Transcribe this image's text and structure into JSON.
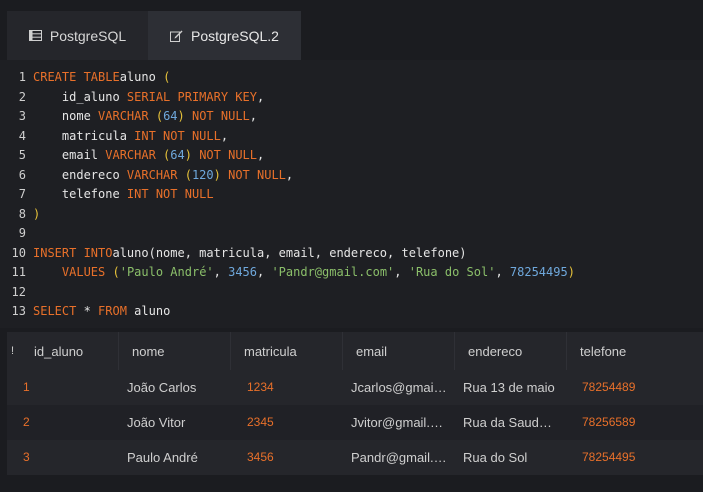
{
  "tabs": [
    {
      "label": "PostgreSQL",
      "icon": "database-icon"
    },
    {
      "label": "PostgreSQL.2",
      "icon": "edit-icon"
    }
  ],
  "editor": {
    "lines": [
      {
        "n": "1",
        "parts": [
          [
            "kw",
            "CREATE TABLE"
          ],
          [
            "",
            "aluno "
          ],
          [
            "pa",
            "("
          ]
        ]
      },
      {
        "n": "2",
        "parts": [
          [
            "",
            "    id_aluno "
          ],
          [
            "kw",
            "SERIAL PRIMARY KEY"
          ],
          [
            "",
            ","
          ]
        ]
      },
      {
        "n": "3",
        "parts": [
          [
            "",
            "    nome "
          ],
          [
            "kw",
            "VARCHAR "
          ],
          [
            "pa",
            "("
          ],
          [
            "num",
            "64"
          ],
          [
            "pa",
            ")"
          ],
          [
            "kw",
            " NOT NULL"
          ],
          [
            "",
            ","
          ]
        ]
      },
      {
        "n": "4",
        "parts": [
          [
            "",
            "    matricula "
          ],
          [
            "kw",
            "INT NOT NULL"
          ],
          [
            "",
            ","
          ]
        ]
      },
      {
        "n": "5",
        "parts": [
          [
            "",
            "    email "
          ],
          [
            "kw",
            "VARCHAR "
          ],
          [
            "pa",
            "("
          ],
          [
            "num",
            "64"
          ],
          [
            "pa",
            ")"
          ],
          [
            "kw",
            " NOT NULL"
          ],
          [
            "",
            ","
          ]
        ]
      },
      {
        "n": "6",
        "parts": [
          [
            "",
            "    endereco "
          ],
          [
            "kw",
            "VARCHAR "
          ],
          [
            "pa",
            "("
          ],
          [
            "num",
            "120"
          ],
          [
            "pa",
            ")"
          ],
          [
            "kw",
            " NOT NULL"
          ],
          [
            "",
            ","
          ]
        ]
      },
      {
        "n": "7",
        "parts": [
          [
            "",
            "    telefone "
          ],
          [
            "kw",
            "INT NOT NULL"
          ]
        ]
      },
      {
        "n": "8",
        "parts": [
          [
            "pa",
            ")"
          ]
        ]
      },
      {
        "n": "9",
        "parts": []
      },
      {
        "n": "10",
        "parts": [
          [
            "kw",
            "INSERT INTO"
          ],
          [
            "",
            "aluno(nome, matricula, email, endereco, telefone)"
          ]
        ]
      },
      {
        "n": "11",
        "parts": [
          [
            "",
            "    "
          ],
          [
            "kw",
            "VALUES "
          ],
          [
            "pa",
            "("
          ],
          [
            "str",
            "'Paulo André'"
          ],
          [
            "",
            ", "
          ],
          [
            "num",
            "3456"
          ],
          [
            "",
            ", "
          ],
          [
            "str",
            "'Pandr@gmail.com'"
          ],
          [
            "",
            ", "
          ],
          [
            "str",
            "'Rua do Sol'"
          ],
          [
            "",
            ", "
          ],
          [
            "num",
            "78254495"
          ],
          [
            "pa",
            ")"
          ]
        ]
      },
      {
        "n": "12",
        "parts": []
      },
      {
        "n": "13",
        "parts": [
          [
            "kw",
            "SELECT"
          ],
          [
            "",
            " * "
          ],
          [
            "kw",
            "FROM"
          ],
          [
            "",
            " aluno"
          ]
        ]
      }
    ]
  },
  "results": {
    "row_marker": "!",
    "columns": [
      "id_aluno",
      "nome",
      "matricula",
      "email",
      "endereco",
      "telefone"
    ],
    "rows": [
      [
        "1",
        "João Carlos",
        "1234",
        "Jcarlos@gmail.com",
        "Rua 13 de maio",
        "78254489"
      ],
      [
        "2",
        "João Vitor",
        "2345",
        "Jvitor@gmail.com",
        "Rua da Saudade",
        "78256589"
      ],
      [
        "3",
        "Paulo André",
        "3456",
        "Pandr@gmail.com",
        "Rua do Sol",
        "78254495"
      ]
    ]
  },
  "colors": {
    "keyword": "#e8702a",
    "number": "#6fa8dc",
    "string": "#8bbf6a",
    "paren": "#e6c23a",
    "background": "#1b1c20"
  }
}
